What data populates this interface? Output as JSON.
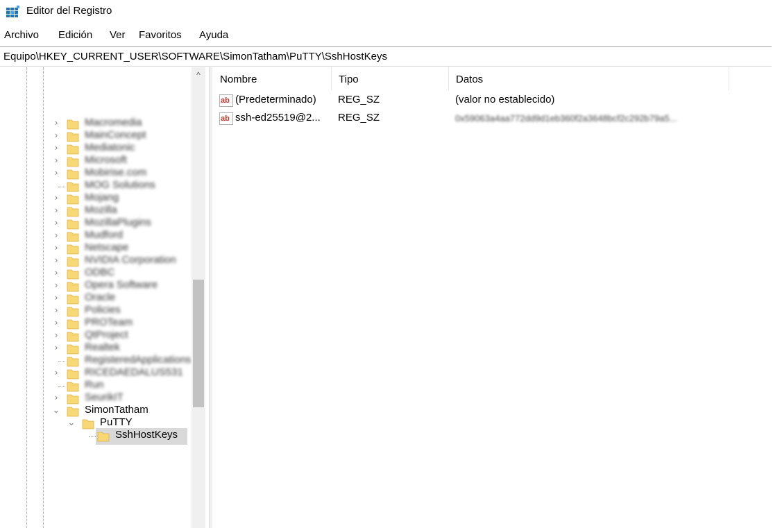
{
  "window": {
    "title": "Editor del Registro"
  },
  "menu": [
    "Archivo",
    "Edición",
    "Ver",
    "Favoritos",
    "Ayuda"
  ],
  "address": "Equipo\\HKEY_CURRENT_USER\\SOFTWARE\\SimonTatham\\PuTTY\\SshHostKeys",
  "tree": {
    "items": [
      {
        "label": "Macromedia",
        "blurred": true,
        "expander": "collapsed"
      },
      {
        "label": "MainConcept",
        "blurred": true,
        "expander": "collapsed"
      },
      {
        "label": "Mediatonic",
        "blurred": true,
        "expander": "collapsed"
      },
      {
        "label": "Microsoft",
        "blurred": true,
        "expander": "collapsed"
      },
      {
        "label": "Mobirise.com",
        "blurred": true,
        "expander": "collapsed"
      },
      {
        "label": "MOG Solutions",
        "blurred": true,
        "expander": "none"
      },
      {
        "label": "Mojang",
        "blurred": true,
        "expander": "collapsed"
      },
      {
        "label": "Mozilla",
        "blurred": true,
        "expander": "collapsed"
      },
      {
        "label": "MozillaPlugins",
        "blurred": true,
        "expander": "collapsed"
      },
      {
        "label": "Mudford",
        "blurred": true,
        "expander": "collapsed"
      },
      {
        "label": "Netscape",
        "blurred": true,
        "expander": "collapsed"
      },
      {
        "label": "NVIDIA Corporation",
        "blurred": true,
        "expander": "collapsed"
      },
      {
        "label": "ODBC",
        "blurred": true,
        "expander": "collapsed"
      },
      {
        "label": "Opera Software",
        "blurred": true,
        "expander": "collapsed"
      },
      {
        "label": "Oracle",
        "blurred": true,
        "expander": "collapsed"
      },
      {
        "label": "Policies",
        "blurred": true,
        "expander": "collapsed"
      },
      {
        "label": "PROTeam",
        "blurred": true,
        "expander": "collapsed"
      },
      {
        "label": "QtProject",
        "blurred": true,
        "expander": "collapsed"
      },
      {
        "label": "Realtek",
        "blurred": true,
        "expander": "collapsed"
      },
      {
        "label": "RegisteredApplications",
        "blurred": true,
        "expander": "none"
      },
      {
        "label": "RICEDAEDALUS531",
        "blurred": true,
        "expander": "collapsed"
      },
      {
        "label": "Run",
        "blurred": true,
        "expander": "none"
      },
      {
        "label": "SeurikIT",
        "blurred": true,
        "expander": "collapsed"
      },
      {
        "label": "SimonTatham",
        "blurred": false,
        "expander": "expanded"
      }
    ],
    "child": {
      "label": "PuTTY",
      "expander": "expanded"
    },
    "grandchild": {
      "label": "SshHostKeys",
      "selected": true
    }
  },
  "list": {
    "columns": [
      "Nombre",
      "Tipo",
      "Datos"
    ],
    "rows": [
      {
        "name": "(Predeterminado)",
        "type": "REG_SZ",
        "data": "(valor no establecido)",
        "data_blurred": false,
        "icon": "reg-string-icon"
      },
      {
        "name": "ssh-ed25519@2...",
        "type": "REG_SZ",
        "data": "0x59063a4aa772dd9d1eb360f2a3648bcf2c292b79a5...",
        "data_blurred": true,
        "icon": "reg-string-icon"
      }
    ]
  },
  "colors": {
    "folder": "#f8d775",
    "folder_dark": "#e0b040",
    "selection": "#d9d9d9",
    "reg_icon_red": "#c0392b"
  }
}
